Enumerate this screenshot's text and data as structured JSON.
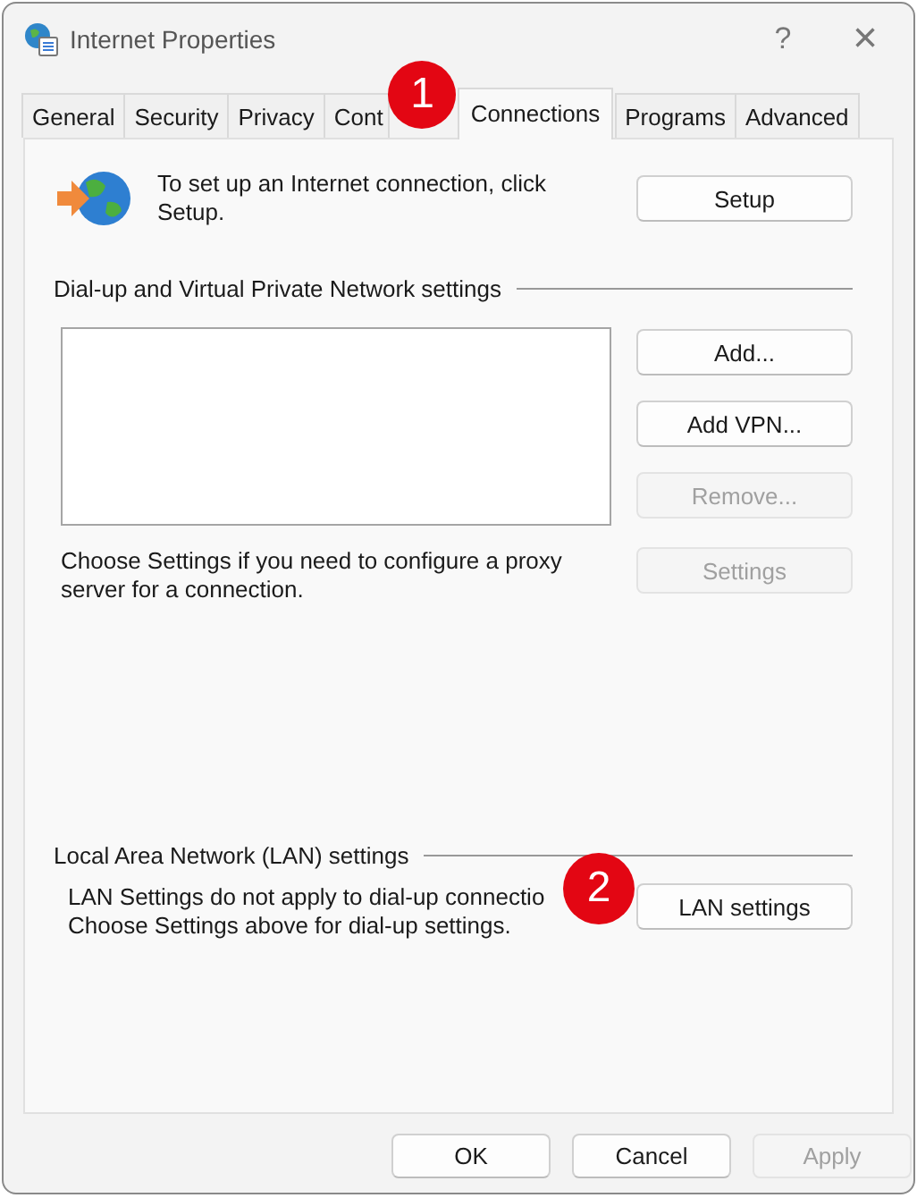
{
  "window": {
    "title": "Internet Properties",
    "help": "?",
    "close": "×"
  },
  "tabs": [
    {
      "label": "General",
      "selected": false
    },
    {
      "label": "Security",
      "selected": false
    },
    {
      "label": "Privacy",
      "selected": false
    },
    {
      "label": "Cont",
      "selected": false
    },
    {
      "label": "Connections",
      "selected": true
    },
    {
      "label": "Programs",
      "selected": false
    },
    {
      "label": "Advanced",
      "selected": false
    }
  ],
  "setup": {
    "text": "To set up an Internet connection, click Setup.",
    "button": {
      "label": "Setup",
      "disabled": false
    }
  },
  "dialup": {
    "heading": "Dial-up and Virtual Private Network settings",
    "buttons": [
      {
        "label": "Add...",
        "disabled": false
      },
      {
        "label": "Add VPN...",
        "disabled": false
      },
      {
        "label": "Remove...",
        "disabled": true
      }
    ],
    "proxy_text": "Choose Settings if you need to configure a proxy server for a connection.",
    "settings_button": {
      "label": "Settings",
      "disabled": true
    }
  },
  "lan": {
    "heading": "Local Area Network (LAN) settings",
    "text_line_1": "LAN Settings do not apply to dial-up connectio",
    "text_line_2": "Choose Settings above for dial-up settings.",
    "button": {
      "label": "LAN settings",
      "disabled": false
    }
  },
  "markers": [
    "1",
    "2"
  ],
  "footer_buttons": [
    {
      "label": "OK",
      "disabled": false
    },
    {
      "label": "Cancel",
      "disabled": false
    },
    {
      "label": "Apply",
      "disabled": true
    }
  ]
}
